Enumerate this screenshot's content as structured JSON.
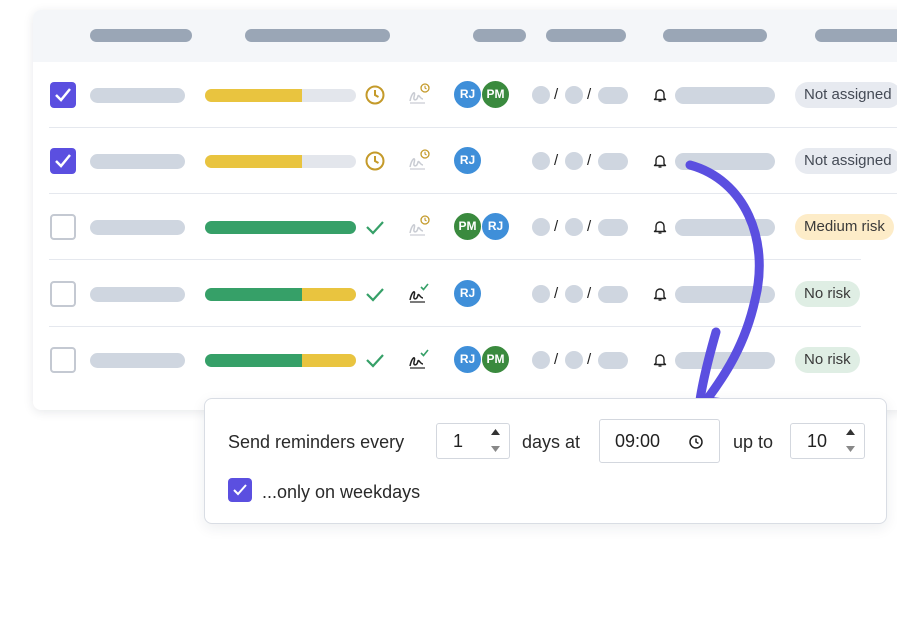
{
  "rows": [
    {
      "checked": true,
      "progress": {
        "segments": [
          {
            "fraction": 0.64,
            "color": "#e9c43f"
          }
        ]
      },
      "status": "clock-icon",
      "signature_state": "pending",
      "avatars": [
        {
          "initials": "RJ",
          "color": "#3f8fd9"
        },
        {
          "initials": "PM",
          "color": "#3a8a3e"
        }
      ],
      "badge": {
        "text": "Not assigned",
        "bg": "#e7eaf0",
        "fg": "#444a55"
      }
    },
    {
      "checked": true,
      "progress": {
        "segments": [
          {
            "fraction": 0.64,
            "color": "#e9c43f"
          }
        ]
      },
      "status": "clock-icon",
      "signature_state": "pending",
      "avatars": [
        {
          "initials": "RJ",
          "color": "#3f8fd9"
        }
      ],
      "badge": {
        "text": "Not assigned",
        "bg": "#e7eaf0",
        "fg": "#444a55"
      }
    },
    {
      "checked": false,
      "progress": {
        "segments": [
          {
            "fraction": 1.0,
            "color": "#36a068"
          }
        ]
      },
      "status": "check-icon",
      "signature_state": "pending",
      "avatars": [
        {
          "initials": "PM",
          "color": "#3a8a3e"
        },
        {
          "initials": "RJ",
          "color": "#3f8fd9"
        }
      ],
      "badge": {
        "text": "Medium risk",
        "bg": "#fdecc8",
        "fg": "#3a3a3a"
      }
    },
    {
      "checked": false,
      "progress": {
        "segments": [
          {
            "fraction": 0.64,
            "color": "#36a068"
          },
          {
            "fraction": 0.36,
            "color": "#e9c43f"
          }
        ]
      },
      "status": "check-icon",
      "signature_state": "signed",
      "avatars": [
        {
          "initials": "RJ",
          "color": "#3f8fd9"
        }
      ],
      "badge": {
        "text": "No risk",
        "bg": "#dfeee4",
        "fg": "#3a3a3a"
      }
    },
    {
      "checked": false,
      "progress": {
        "segments": [
          {
            "fraction": 0.64,
            "color": "#36a068"
          },
          {
            "fraction": 0.36,
            "color": "#e9c43f"
          }
        ]
      },
      "status": "check-icon",
      "signature_state": "signed",
      "avatars": [
        {
          "initials": "RJ",
          "color": "#3f8fd9"
        },
        {
          "initials": "PM",
          "color": "#3a8a3e"
        }
      ],
      "badge": {
        "text": "No risk",
        "bg": "#dfeee4",
        "fg": "#3a3a3a"
      }
    }
  ],
  "date_separator": "/",
  "reminder": {
    "label_prefix": "Send reminders every",
    "every_days": "1",
    "label_days_at": "days at",
    "time": "09:00",
    "label_up_to": "up to",
    "max_count": "10",
    "weekdays_label": "...only on weekdays",
    "weekdays_checked": true
  },
  "colors": {
    "accent": "#5b4fe0",
    "arrow": "#5b4fe0"
  }
}
